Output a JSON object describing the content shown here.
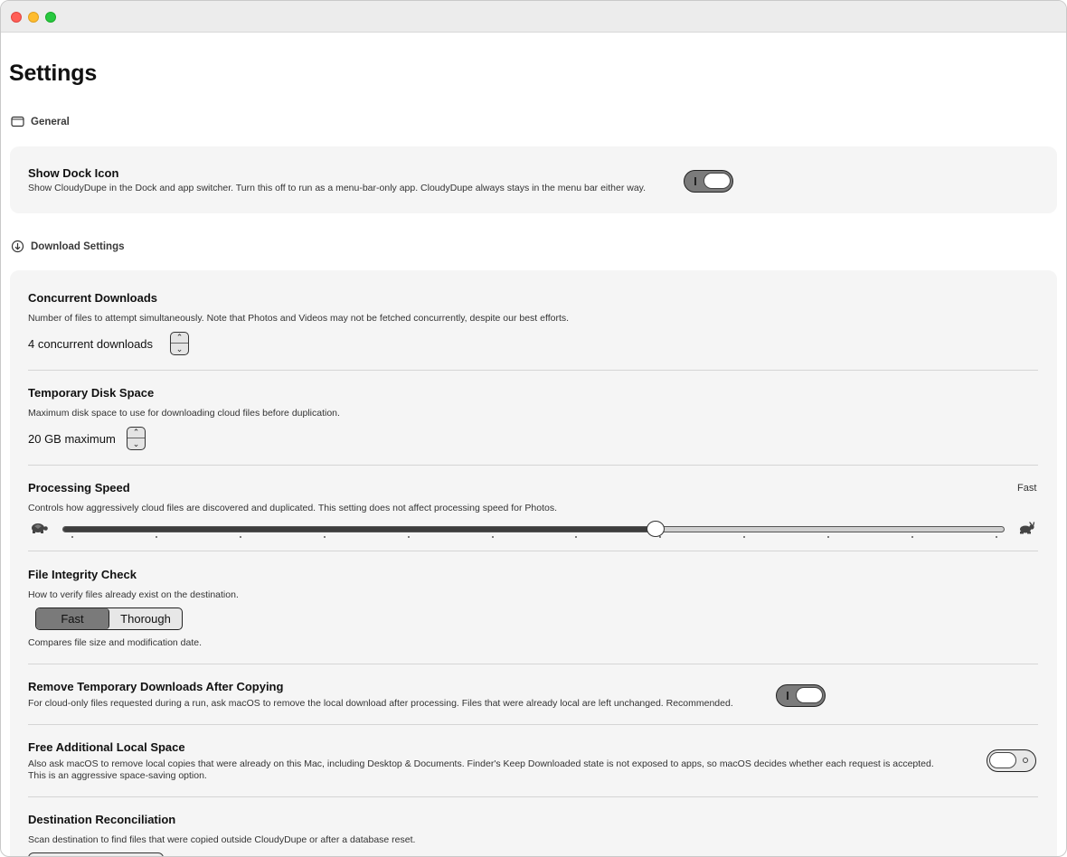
{
  "page": {
    "title": "Settings"
  },
  "general": {
    "section_label": "General",
    "show_dock_icon": {
      "title": "Show Dock Icon",
      "description": "Show CloudyDupe in the Dock and app switcher. Turn this off to run as a menu-bar-only app. CloudyDupe always stays in the menu bar either way.",
      "enabled": true
    }
  },
  "download": {
    "section_label": "Download Settings",
    "concurrent": {
      "title": "Concurrent Downloads",
      "description": "Number of files to attempt simultaneously. Note that Photos and Videos may not be fetched concurrently, despite our best efforts.",
      "value_label": "4 concurrent downloads"
    },
    "disk_space": {
      "title": "Temporary Disk Space",
      "description": "Maximum disk space to use for downloading cloud files before duplication.",
      "value_label": "20 GB maximum"
    },
    "speed": {
      "title": "Processing Speed",
      "description": "Controls how aggressively cloud files are discovered and duplicated. This setting does not affect processing speed for Photos.",
      "current_label": "Fast",
      "level_fraction": 0.63,
      "slow_icon": "tortoise-icon",
      "fast_icon": "hare-icon"
    },
    "integrity": {
      "title": "File Integrity Check",
      "description": "How to verify files already exist on the destination.",
      "options": [
        "Fast",
        "Thorough"
      ],
      "selected": "Fast",
      "note": "Compares file size and modification date."
    },
    "remove_temp": {
      "title": "Remove Temporary Downloads After Copying",
      "description": "For cloud-only files requested during a run, ask macOS to remove the local download after processing. Files that were already local are left unchanged. Recommended.",
      "enabled": true
    },
    "free_space": {
      "title": "Free Additional Local Space",
      "description_line1": "Also ask macOS to remove local copies that were already on this Mac, including Desktop & Documents. Finder's Keep Downloaded state is not exposed to apps, so macOS decides whether each request is accepted.",
      "description_line2": "This is an aggressive space-saving option.",
      "enabled": false
    },
    "reconcile": {
      "title": "Destination Reconciliation",
      "description": "Scan destination to find files that were copied outside CloudyDupe or after a database reset."
    }
  }
}
